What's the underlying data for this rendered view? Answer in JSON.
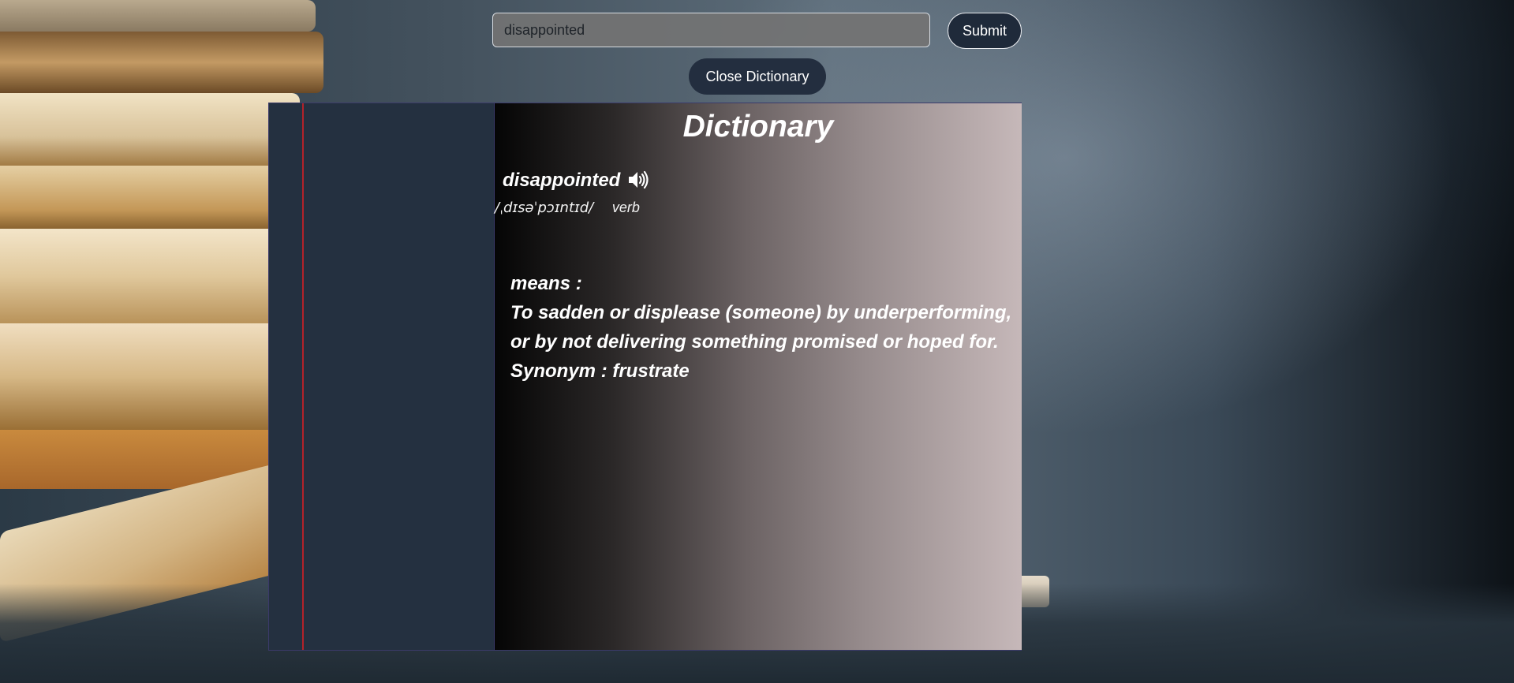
{
  "search": {
    "value": "disappointed",
    "submit_label": "Submit"
  },
  "toolbar": {
    "close_label": "Close Dictionary"
  },
  "dictionary": {
    "title": "Dictionary",
    "word": "disappointed",
    "speaker_icon": "speaker-icon",
    "pronunciation": "/ˌdɪsəˈpɔɪntɪd/",
    "part_of_speech": "verb",
    "means_label": "means :",
    "definition_line1": "To sadden or displease (someone) by underperforming,",
    "definition_line2": "or by not delivering something promised or hoped for.",
    "synonym": "Synonym : frustrate"
  },
  "colors": {
    "panel": "#243040",
    "margin_line": "#b3222a",
    "button": "#1f2a3a",
    "text": "#ffffff"
  }
}
